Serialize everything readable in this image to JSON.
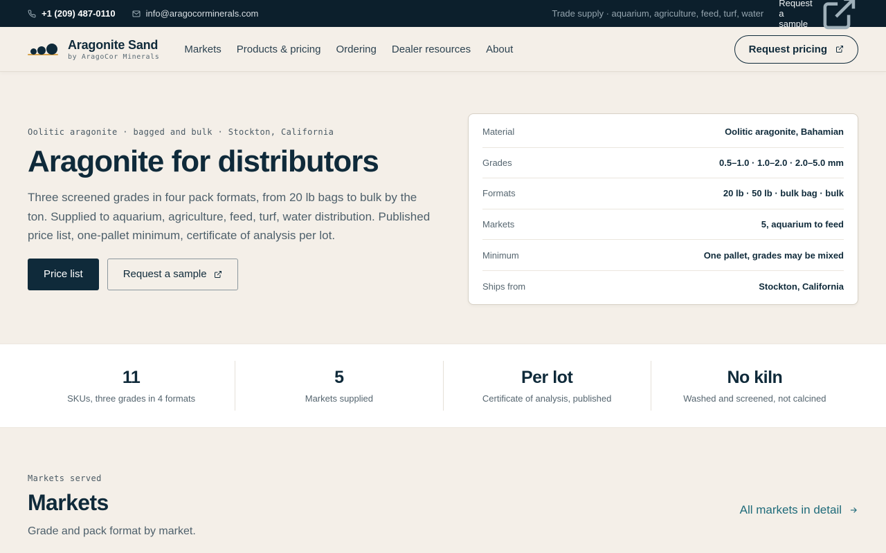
{
  "topbar": {
    "phone": "+1 (209) 487-0110",
    "email": "info@aragocorminerals.com",
    "tagline": "Trade supply · aquarium, agriculture, feed, turf, water",
    "sample_link": "Request a sample"
  },
  "header": {
    "brand_name": "Aragonite Sand",
    "brand_sub": "by AragoCor Minerals",
    "nav": [
      "Markets",
      "Products & pricing",
      "Ordering",
      "Dealer resources",
      "About"
    ],
    "cta": "Request pricing"
  },
  "hero": {
    "eyebrow": "Oolitic aragonite · bagged and bulk · Stockton, California",
    "title": "Aragonite for distributors",
    "description": "Three screened grades in four pack formats, from 20 lb bags to bulk by the ton. Supplied to aquarium, agriculture, feed, turf, water distribution. Published price list, one-pallet minimum, certificate of analysis per lot.",
    "primary_button": "Price list",
    "secondary_button": "Request a sample"
  },
  "specs": [
    {
      "key": "Material",
      "value": "Oolitic aragonite, Bahamian"
    },
    {
      "key": "Grades",
      "value": "0.5–1.0 · 1.0–2.0 · 2.0–5.0 mm"
    },
    {
      "key": "Formats",
      "value": "20 lb · 50 lb · bulk bag · bulk"
    },
    {
      "key": "Markets",
      "value": "5, aquarium to feed"
    },
    {
      "key": "Minimum",
      "value": "One pallet, grades may be mixed"
    },
    {
      "key": "Ships from",
      "value": "Stockton, California"
    }
  ],
  "stats": [
    {
      "value": "11",
      "label": "SKUs, three grades in 4 formats"
    },
    {
      "value": "5",
      "label": "Markets supplied"
    },
    {
      "value": "Per lot",
      "label": "Certificate of analysis, published"
    },
    {
      "value": "No kiln",
      "label": "Washed and screened, not calcined"
    }
  ],
  "markets": {
    "eyebrow": "Markets served",
    "title": "Markets",
    "description": "Grade and pack format by market.",
    "link": "All markets in detail"
  },
  "colors": {
    "navy": "#0c1f2c",
    "ink": "#0f2a3a",
    "sand": "#f4efe8",
    "accent_gold": "#d6a24a",
    "link_teal": "#1f6b7a"
  },
  "icons": {
    "phone": "phone-icon",
    "email": "mail-icon",
    "external": "external-link-icon",
    "arrow": "arrow-right-icon"
  }
}
